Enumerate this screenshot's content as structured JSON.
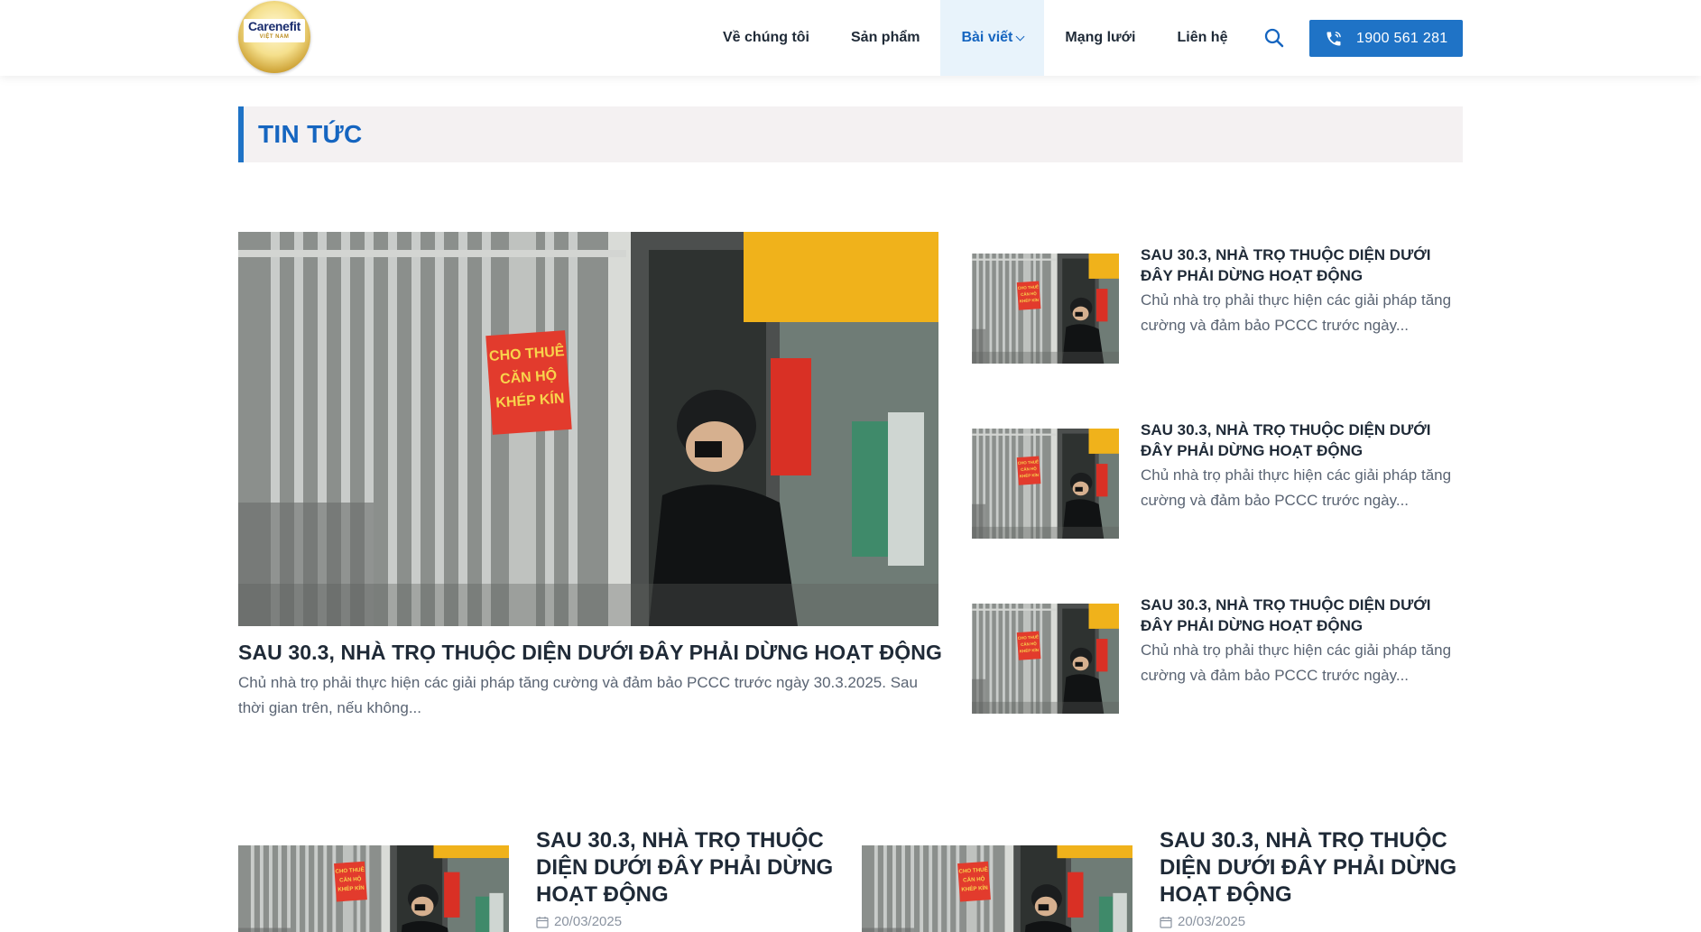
{
  "brand": {
    "logo_text": "Carenefit",
    "logo_sub": "VIỆT NAM"
  },
  "nav": {
    "items": [
      {
        "label": "Về chúng tôi",
        "active": false
      },
      {
        "label": "Sản phẩm",
        "active": false
      },
      {
        "label": "Bài viết",
        "active": true,
        "has_dropdown": true
      },
      {
        "label": "Mạng lưới",
        "active": false
      },
      {
        "label": "Liên hệ",
        "active": false
      }
    ],
    "search_icon": "search-icon",
    "phone": "1900 561 281",
    "phone_icon": "phone-icon"
  },
  "page": {
    "title": "TIN TỨC"
  },
  "featured": {
    "title": "SAU 30.3, NHÀ TRỌ THUỘC DIỆN DƯỚI ĐÂY PHẢI DỪNG HOẠT ĐỘNG",
    "excerpt": "Chủ nhà trọ phải thực hiện các giải pháp tăng cường và đảm bảo PCCC trước ngày 30.3.2025. Sau thời gian trên, nếu không...",
    "image_sign_text": [
      "CHO THUÊ",
      "CĂN HỘ",
      "KHÉP KÍN"
    ]
  },
  "side_posts": [
    {
      "title": "SAU 30.3, NHÀ TRỌ THUỘC DIỆN DƯỚI ĐÂY PHẢI DỪNG HOẠT ĐỘNG",
      "excerpt": "Chủ nhà trọ phải thực hiện các giải pháp tăng cường và đảm bảo PCCC trước ngày..."
    },
    {
      "title": "SAU 30.3, NHÀ TRỌ THUỘC DIỆN DƯỚI ĐÂY PHẢI DỪNG HOẠT ĐỘNG",
      "excerpt": "Chủ nhà trọ phải thực hiện các giải pháp tăng cường và đảm bảo PCCC trước ngày..."
    },
    {
      "title": "SAU 30.3, NHÀ TRỌ THUỘC DIỆN DƯỚI ĐÂY PHẢI DỪNG HOẠT ĐỘNG",
      "excerpt": "Chủ nhà trọ phải thực hiện các giải pháp tăng cường và đảm bảo PCCC trước ngày..."
    }
  ],
  "grid_posts": [
    {
      "title": "SAU 30.3, NHÀ TRỌ THUỘC DIỆN DƯỚI ĐÂY PHẢI DỪNG HOẠT ĐỘNG",
      "date": "20/03/2025"
    },
    {
      "title": "SAU 30.3, NHÀ TRỌ THUỘC DIỆN DƯỚI ĐÂY PHẢI DỪNG HOẠT ĐỘNG",
      "date": "20/03/2025"
    }
  ],
  "colors": {
    "accent": "#1f73c6",
    "nav_active_bg": "#e8f3fb",
    "title_bar_bg": "#f4f1f2",
    "text": "#1f2a37",
    "muted": "#5a6473"
  }
}
